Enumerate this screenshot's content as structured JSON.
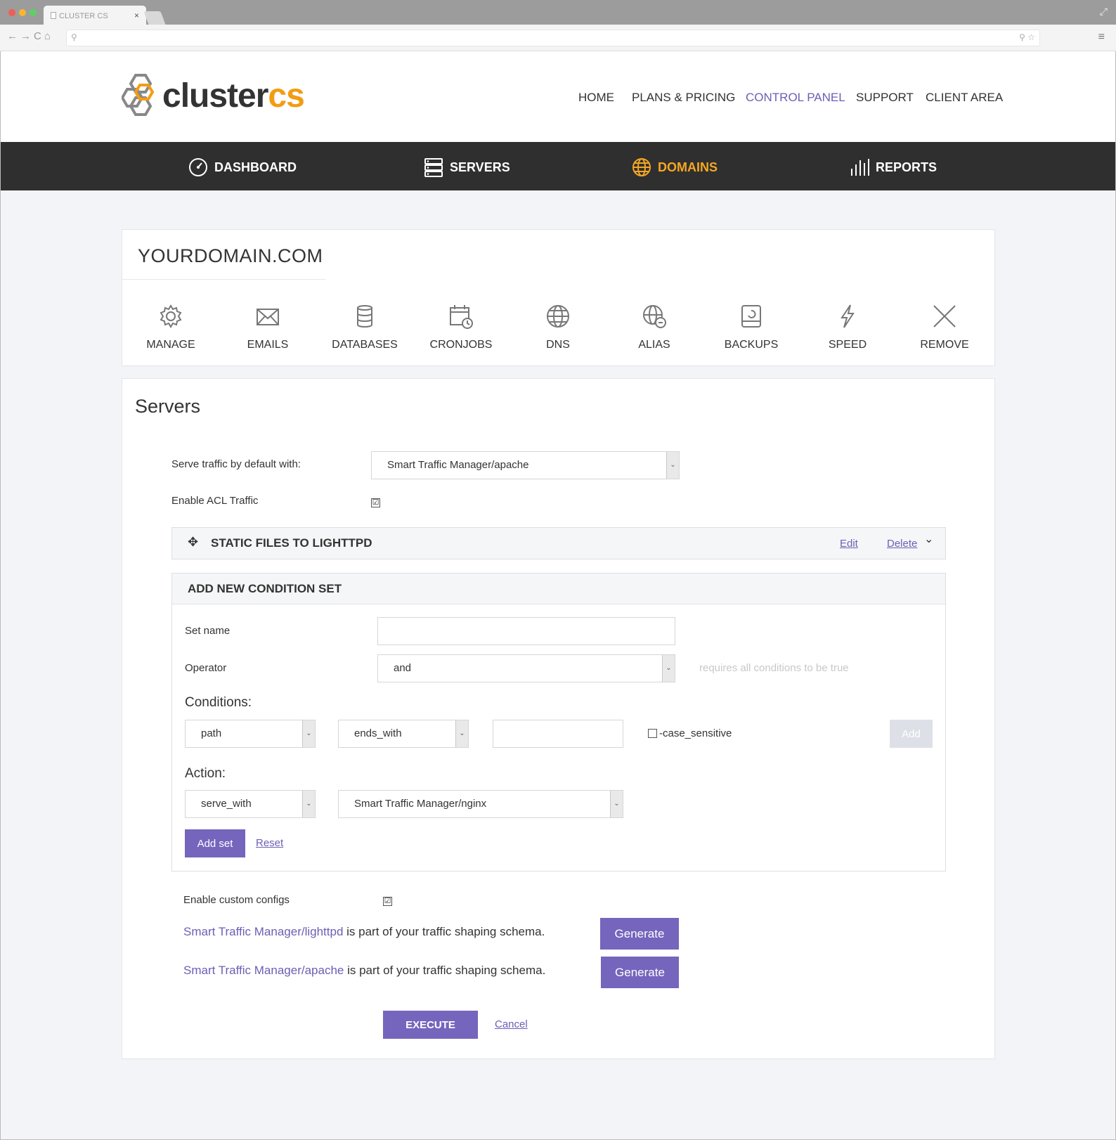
{
  "browser": {
    "tab_title": "CLUSTER CS",
    "tab_close": "×",
    "nav_glyphs": "←→C⌂"
  },
  "header": {
    "logo_main": "cluster",
    "logo_accent": "cs",
    "nav": [
      "HOME",
      "PLANS & PRICING",
      "CONTROL PANEL",
      "SUPPORT",
      "CLIENT AREA"
    ],
    "active_nav": "CONTROL PANEL"
  },
  "mainnav": {
    "items": [
      {
        "label": "DASHBOARD",
        "icon": "dashboard-icon"
      },
      {
        "label": "SERVERS",
        "icon": "servers-icon"
      },
      {
        "label": "DOMAINS",
        "icon": "globe-icon"
      },
      {
        "label": "REPORTS",
        "icon": "bars-icon"
      }
    ],
    "active": "DOMAINS",
    "accent_color": "#f5a623"
  },
  "domain": {
    "title": "YOURDOMAIN.COM",
    "tools": [
      {
        "label": "MANAGE",
        "icon": "gear-icon"
      },
      {
        "label": "EMAILS",
        "icon": "envelope-icon"
      },
      {
        "label": "DATABASES",
        "icon": "database-icon"
      },
      {
        "label": "CRONJOBS",
        "icon": "calendar-clock-icon"
      },
      {
        "label": "DNS",
        "icon": "globe-icon"
      },
      {
        "label": "ALIAS",
        "icon": "globe-alias-icon"
      },
      {
        "label": "BACKUPS",
        "icon": "backup-drive-icon"
      },
      {
        "label": "SPEED",
        "icon": "lightning-icon"
      },
      {
        "label": "REMOVE",
        "icon": "close-icon"
      }
    ]
  },
  "servers": {
    "title": "Servers",
    "default_label": "Serve traffic by default with:",
    "default_value": "Smart Traffic Manager/apache",
    "acl_label": "Enable ACL Traffic",
    "acl_checked": "☑",
    "static_set": {
      "title": "STATIC FILES TO LIGHTTPD",
      "edit": "Edit",
      "delete": "Delete",
      "move_glyph": "✥",
      "toggle_glyph": "⌄"
    },
    "new_set": {
      "header": "ADD NEW CONDITION SET",
      "set_name_label": "Set name",
      "set_name_value": "",
      "operator_label": "Operator",
      "operator_value": "and",
      "operator_hint": "requires all conditions to be true",
      "conditions_label": "Conditions:",
      "cond_field": "path",
      "cond_op": "ends_with",
      "cond_value": "",
      "case_label": "-case_sensitive",
      "add_label": "Add",
      "action_label": "Action:",
      "action_type": "serve_with",
      "action_target": "Smart Traffic Manager/nginx",
      "add_set_label": "Add set",
      "reset_label": "Reset"
    },
    "custom_label": "Enable custom configs",
    "custom_checked": "☑",
    "schema_rows": [
      {
        "link": "Smart Traffic Manager/lighttpd",
        "text": " is part of your traffic shaping schema.",
        "button": "Generate"
      },
      {
        "link": "Smart Traffic Manager/apache",
        "text": " is part of your traffic shaping schema.",
        "button": "Generate"
      }
    ],
    "execute_label": "EXECUTE",
    "cancel_label": "Cancel",
    "dropdown_arrow": "⌄"
  },
  "colors": {
    "primary": "#7565bd",
    "link": "#6b5fb5",
    "nav_bg": "#2f2f2f",
    "accent": "#f5a623"
  }
}
